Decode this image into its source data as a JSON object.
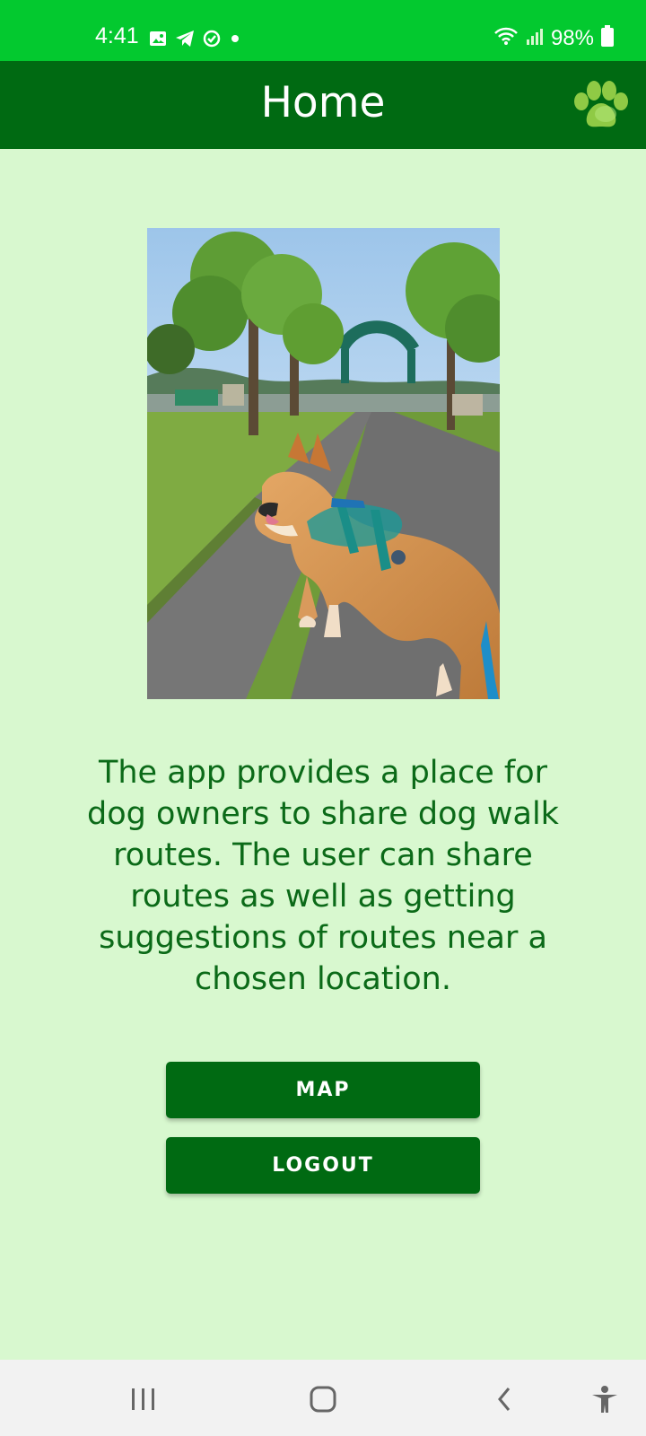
{
  "status_bar": {
    "time": "4:41",
    "battery": "98%",
    "left_icons": [
      "gallery-icon",
      "telegram-icon",
      "check-circle-icon",
      "notification-dot-icon"
    ],
    "right_icons": [
      "wifi-icon",
      "signal-icon",
      "battery-icon"
    ]
  },
  "app_bar": {
    "title": "Home",
    "action_icon": "paw-icon"
  },
  "main": {
    "photo_alt": "Dog on a park path",
    "description": "The app provides a place for dog owners to share dog walk routes. The user can share routes as well as getting suggestions of routes near a chosen location.",
    "buttons": {
      "map": "MAP",
      "logout": "LOGOUT"
    }
  },
  "nav_bar": {
    "items": [
      "recents-icon",
      "home-icon",
      "back-icon",
      "accessibility-icon"
    ]
  },
  "colors": {
    "status_bar": "#03c92f",
    "app_bar": "#006a12",
    "background": "#d8f8cf",
    "text": "#0b6a18",
    "button": "#006a12",
    "paw": "#8fca45"
  }
}
